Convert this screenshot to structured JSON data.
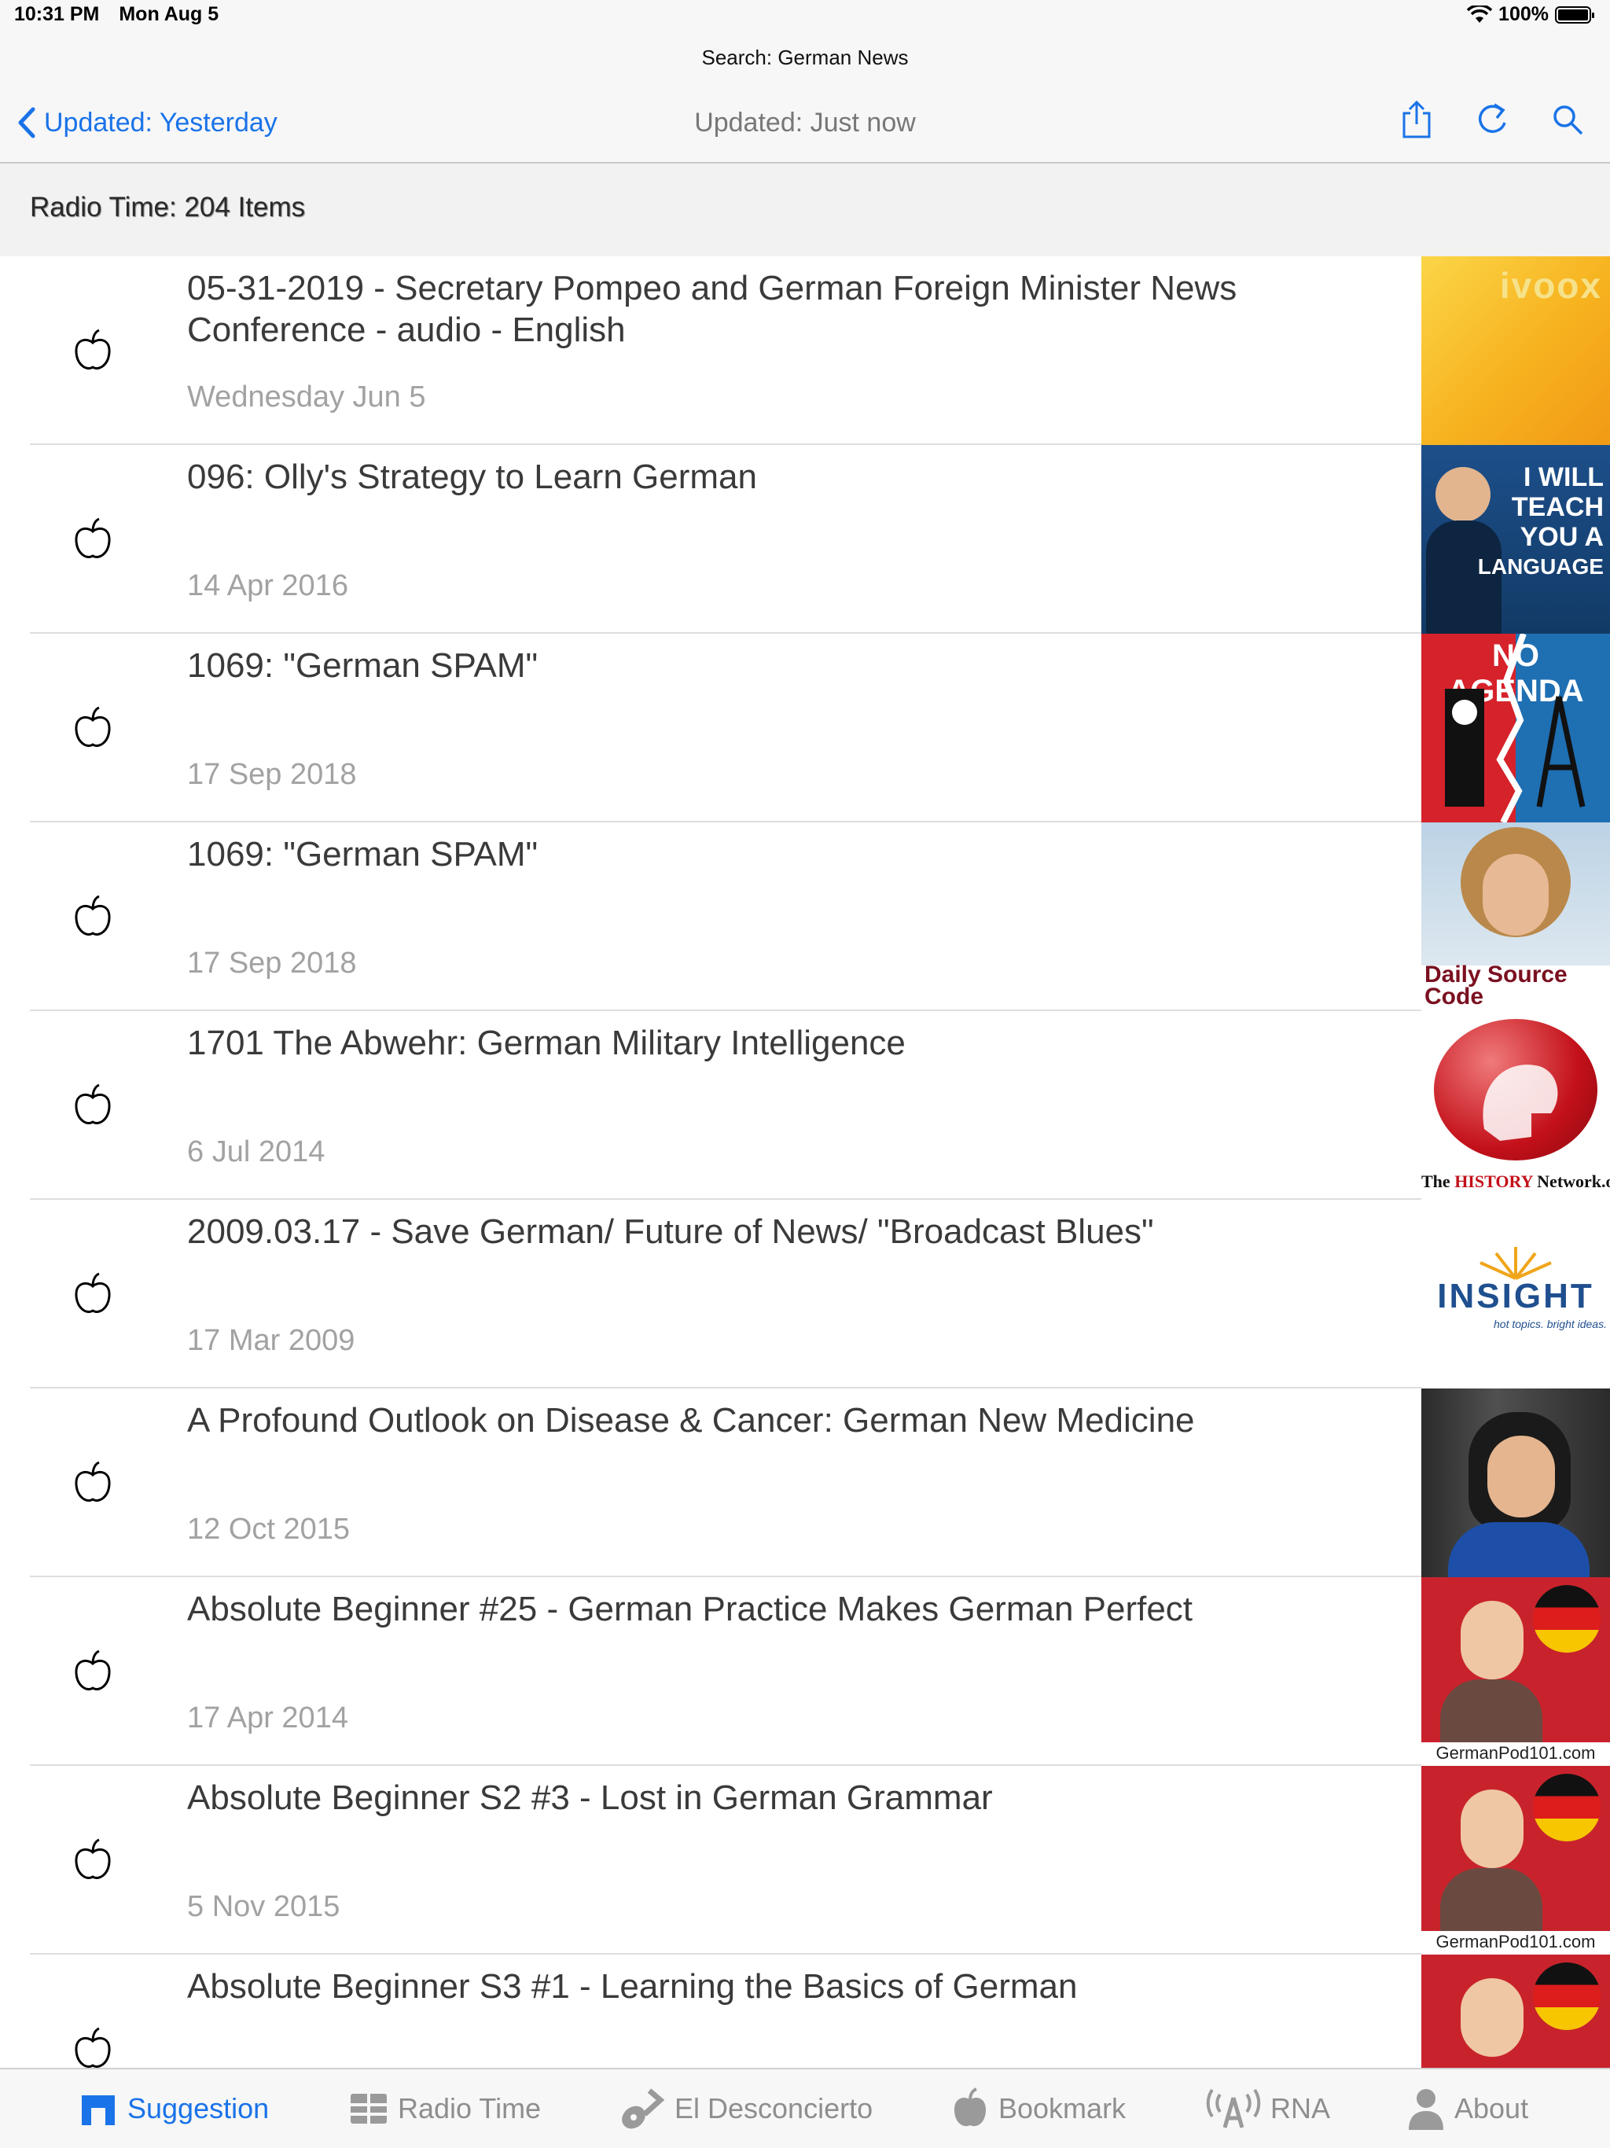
{
  "status_bar": {
    "time": "10:31 PM",
    "date": "Mon Aug 5",
    "battery": "100%"
  },
  "nav": {
    "subtitle": "Search: German News",
    "back_label": "Updated: Yesterday",
    "title": "Updated: Just now",
    "accent_color": "#1a73e8"
  },
  "section_header": "Radio Time: 204 Items",
  "rows": [
    {
      "title": "05-31-2019 - Secretary Pompeo and German Foreign Minister News Conference - audio - English",
      "date": "Wednesday Jun 5",
      "thumb": "ivoox"
    },
    {
      "title": "096: Olly's Strategy to Learn German",
      "date": "14 Apr 2016",
      "thumb": "I WILL TEACH YOU A LANGUAGE"
    },
    {
      "title": "1069: \"German SPAM\"",
      "date": "17 Sep 2018",
      "thumb": "NO AGENDA"
    },
    {
      "title": "1069: \"German SPAM\"",
      "date": "17 Sep 2018",
      "thumb": "Daily Source Code"
    },
    {
      "title": "1701 The Abwehr: German Military Intelligence",
      "date": "6 Jul 2014",
      "thumb": "The HISTORY Network.org"
    },
    {
      "title": "2009.03.17 - Save German/ Future of News/ \"Broadcast Blues\"",
      "date": "17 Mar 2009",
      "thumb": "INSIGHT"
    },
    {
      "title": "A Profound Outlook on Disease & Cancer: German New Medicine",
      "date": "12 Oct 2015",
      "thumb": "portrait"
    },
    {
      "title": "Absolute Beginner #25 - German Practice Makes German Perfect",
      "date": "17 Apr 2014",
      "thumb": "GermanPod101.com"
    },
    {
      "title": "Absolute Beginner S2 #3 - Lost in German Grammar",
      "date": "5 Nov 2015",
      "thumb": "GermanPod101.com"
    },
    {
      "title": "Absolute Beginner S3 #1 - Learning the Basics of German",
      "date": "",
      "thumb": "GermanPod101.com"
    }
  ],
  "thumb_text": {
    "ivoox": "ivoox",
    "iwill": [
      "I WILL",
      "TEACH",
      "YOU A",
      "LANGUAGE"
    ],
    "noagenda": "NO AGENDA",
    "dsc": "Daily Source Code",
    "history_pre": "The ",
    "history_mid": "HISTORY",
    "history_post": " Network.org",
    "insight": "INSIGHT",
    "insight_sub": "hot topics. bright ideas.",
    "gp": "GermanPod101.com"
  },
  "tabs": [
    {
      "label": "Suggestion",
      "icon": "arch-icon",
      "active": true
    },
    {
      "label": "Radio Time",
      "icon": "grid-icon",
      "active": false
    },
    {
      "label": "El Desconcierto",
      "icon": "guitar-icon",
      "active": false
    },
    {
      "label": "Bookmark",
      "icon": "apple-icon",
      "active": false
    },
    {
      "label": "RNA",
      "icon": "antenna-icon",
      "active": false
    },
    {
      "label": "About",
      "icon": "person-icon",
      "active": false
    }
  ]
}
